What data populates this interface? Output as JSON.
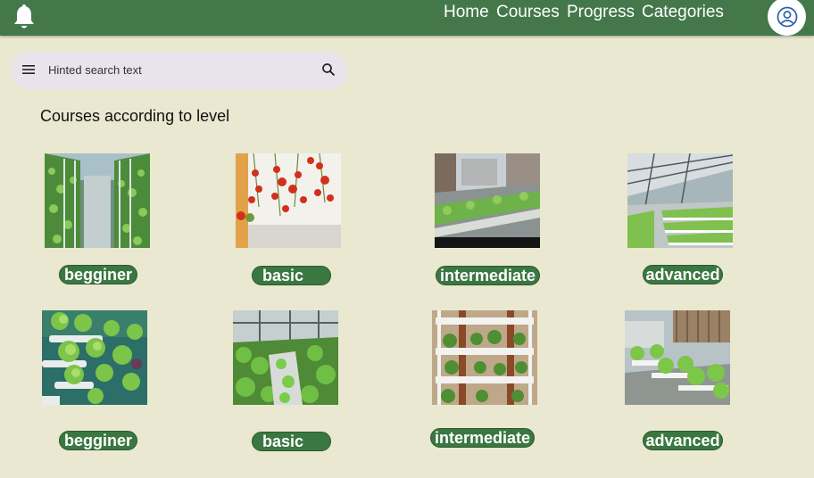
{
  "header": {
    "nav": [
      "Home",
      "Courses",
      "Progress",
      "Categories"
    ]
  },
  "search": {
    "placeholder": "Hinted search text"
  },
  "main": {
    "title": "Courses according to level",
    "rows": [
      {
        "cards": [
          {
            "label": "begginer",
            "image": "vertical-farm-towers"
          },
          {
            "label": "basic",
            "image": "hanging-tomatoes"
          },
          {
            "label": "intermediate",
            "image": "rooftop-hydroponic-beds"
          },
          {
            "label": "advanced",
            "image": "greenhouse-nft-channels"
          }
        ]
      },
      {
        "cards": [
          {
            "label": "begginer",
            "image": "wall-lettuce-planter"
          },
          {
            "label": "basic",
            "image": "indoor-leafy-greens"
          },
          {
            "label": "intermediate",
            "image": "shelf-planter-wall"
          },
          {
            "label": "advanced",
            "image": "rooftop-pipe-system"
          }
        ]
      }
    ]
  },
  "colors": {
    "header": "#44784b",
    "background": "#eae8d0",
    "pill": "#3b7741",
    "search": "#e9e3ec"
  }
}
